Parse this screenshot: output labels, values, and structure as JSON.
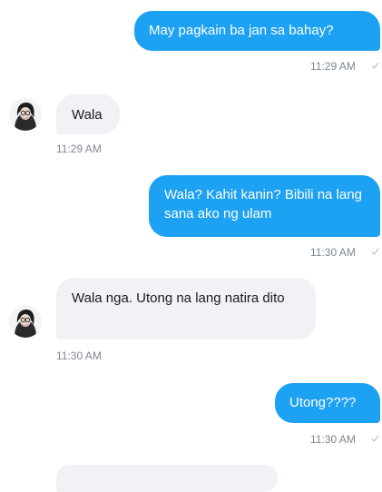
{
  "conversation": {
    "messages": [
      {
        "direction": "outgoing",
        "text": "May pagkain ba jan sa bahay?",
        "time": "11:29 AM"
      },
      {
        "direction": "incoming",
        "text": "Wala",
        "time": "11:29 AM"
      },
      {
        "direction": "outgoing",
        "text": "Wala? Kahit kanin? Bibili na lang sana ako ng ulam",
        "time": "11:30 AM"
      },
      {
        "direction": "incoming",
        "text": "Wala nga. Utong na lang natira dito",
        "time": "11:30 AM"
      },
      {
        "direction": "outgoing",
        "text": "Utong????",
        "time": "11:30 AM"
      }
    ]
  },
  "icons": {
    "read_receipt": "checkmark-icon",
    "sender_avatar": "avatar-icon"
  },
  "colors": {
    "outgoing_bubble": "#1da1f2",
    "incoming_bubble": "#f0f2f5",
    "timestamp": "#7c8791"
  }
}
